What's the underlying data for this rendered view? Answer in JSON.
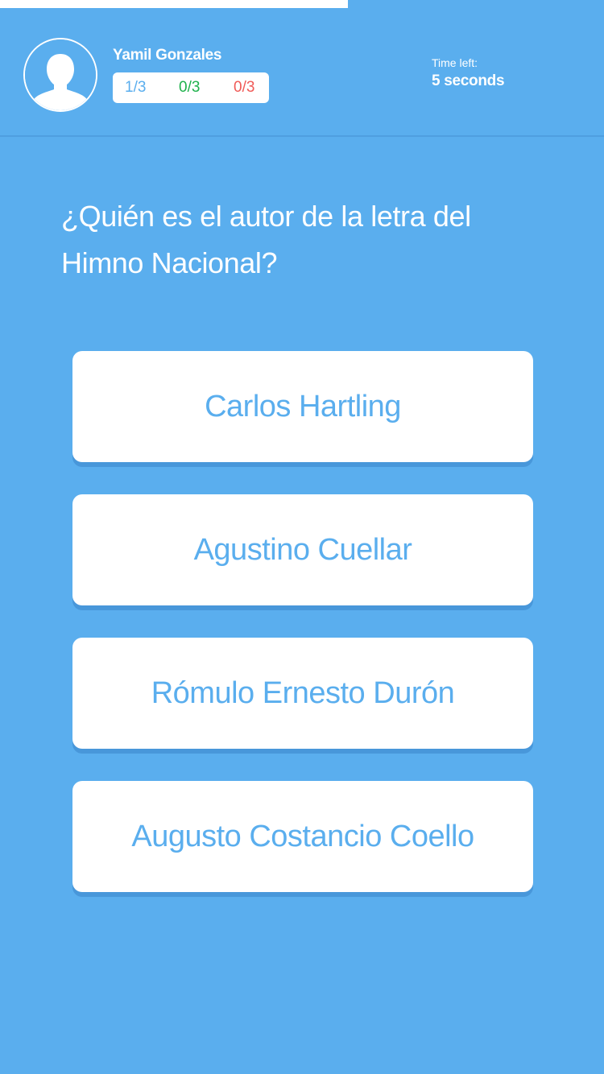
{
  "progress": {
    "fraction": 0.576
  },
  "player": {
    "name": "Yamil Gonzales",
    "avatar_icon": "user-silhouette-icon"
  },
  "scores": {
    "total": "1/3",
    "correct": "0/3",
    "wrong": "0/3"
  },
  "timer": {
    "label": "Time left:",
    "value": "5 seconds"
  },
  "question": {
    "text": "¿Quién es el autor de la letra del Himno Nacional?"
  },
  "answers": [
    {
      "label": "Carlos Hartling"
    },
    {
      "label": "Agustino Cuellar"
    },
    {
      "label": "Rómulo Ernesto Durón"
    },
    {
      "label": "Augusto Costancio Coello"
    }
  ],
  "colors": {
    "background": "#5aaeee",
    "answer_text": "#5aaeee",
    "score_total": "#5aaeee",
    "score_correct": "#1fb14c",
    "score_wrong": "#f05a57",
    "white": "#ffffff"
  }
}
